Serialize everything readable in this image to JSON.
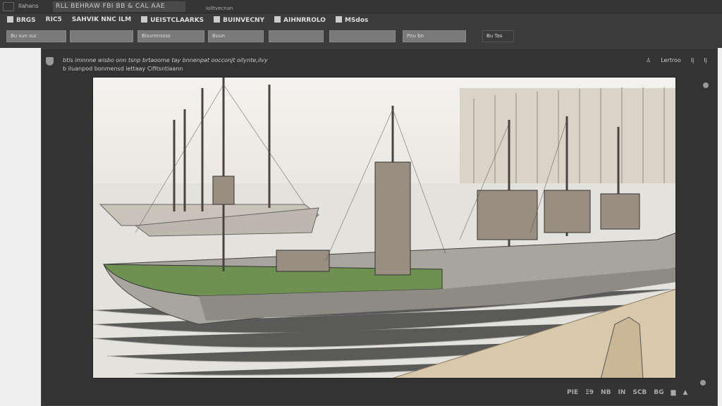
{
  "titlebar": {
    "icon": "window-icon",
    "tab_small": "Ilahans",
    "tab_active": "RLL BEHRAW FBI BB & CAL AAE",
    "tab_other": "Iolltvecnan"
  },
  "menu": [
    "BRGS",
    "RIC5",
    "SAHVIK NNC ILM",
    "UEISTCLAARKS",
    "BUINVECNY",
    "AIHNRROLO",
    "MSdos"
  ],
  "toolbar": [
    "Bu sun sui",
    "",
    "Bisumnssss",
    "Boun",
    "",
    "",
    "Pnu bo",
    "Bu Tas"
  ],
  "panel": {
    "line1": "btis imnnne wisbo onn tsnp brtaoome tay bnnenpat oocconjt oilynte,ilvy",
    "line2": "b iluanpod bonmensd iettaay Cifitsntiaann",
    "tools": [
      "Lertroo",
      "Ij",
      "Ij"
    ]
  },
  "bottom_tools": [
    "PIE",
    "Ξ9",
    "NB",
    "IN",
    "SCB",
    "BG"
  ],
  "colors": {
    "hull": "#6e9152",
    "bg": "#3c3c3c"
  }
}
